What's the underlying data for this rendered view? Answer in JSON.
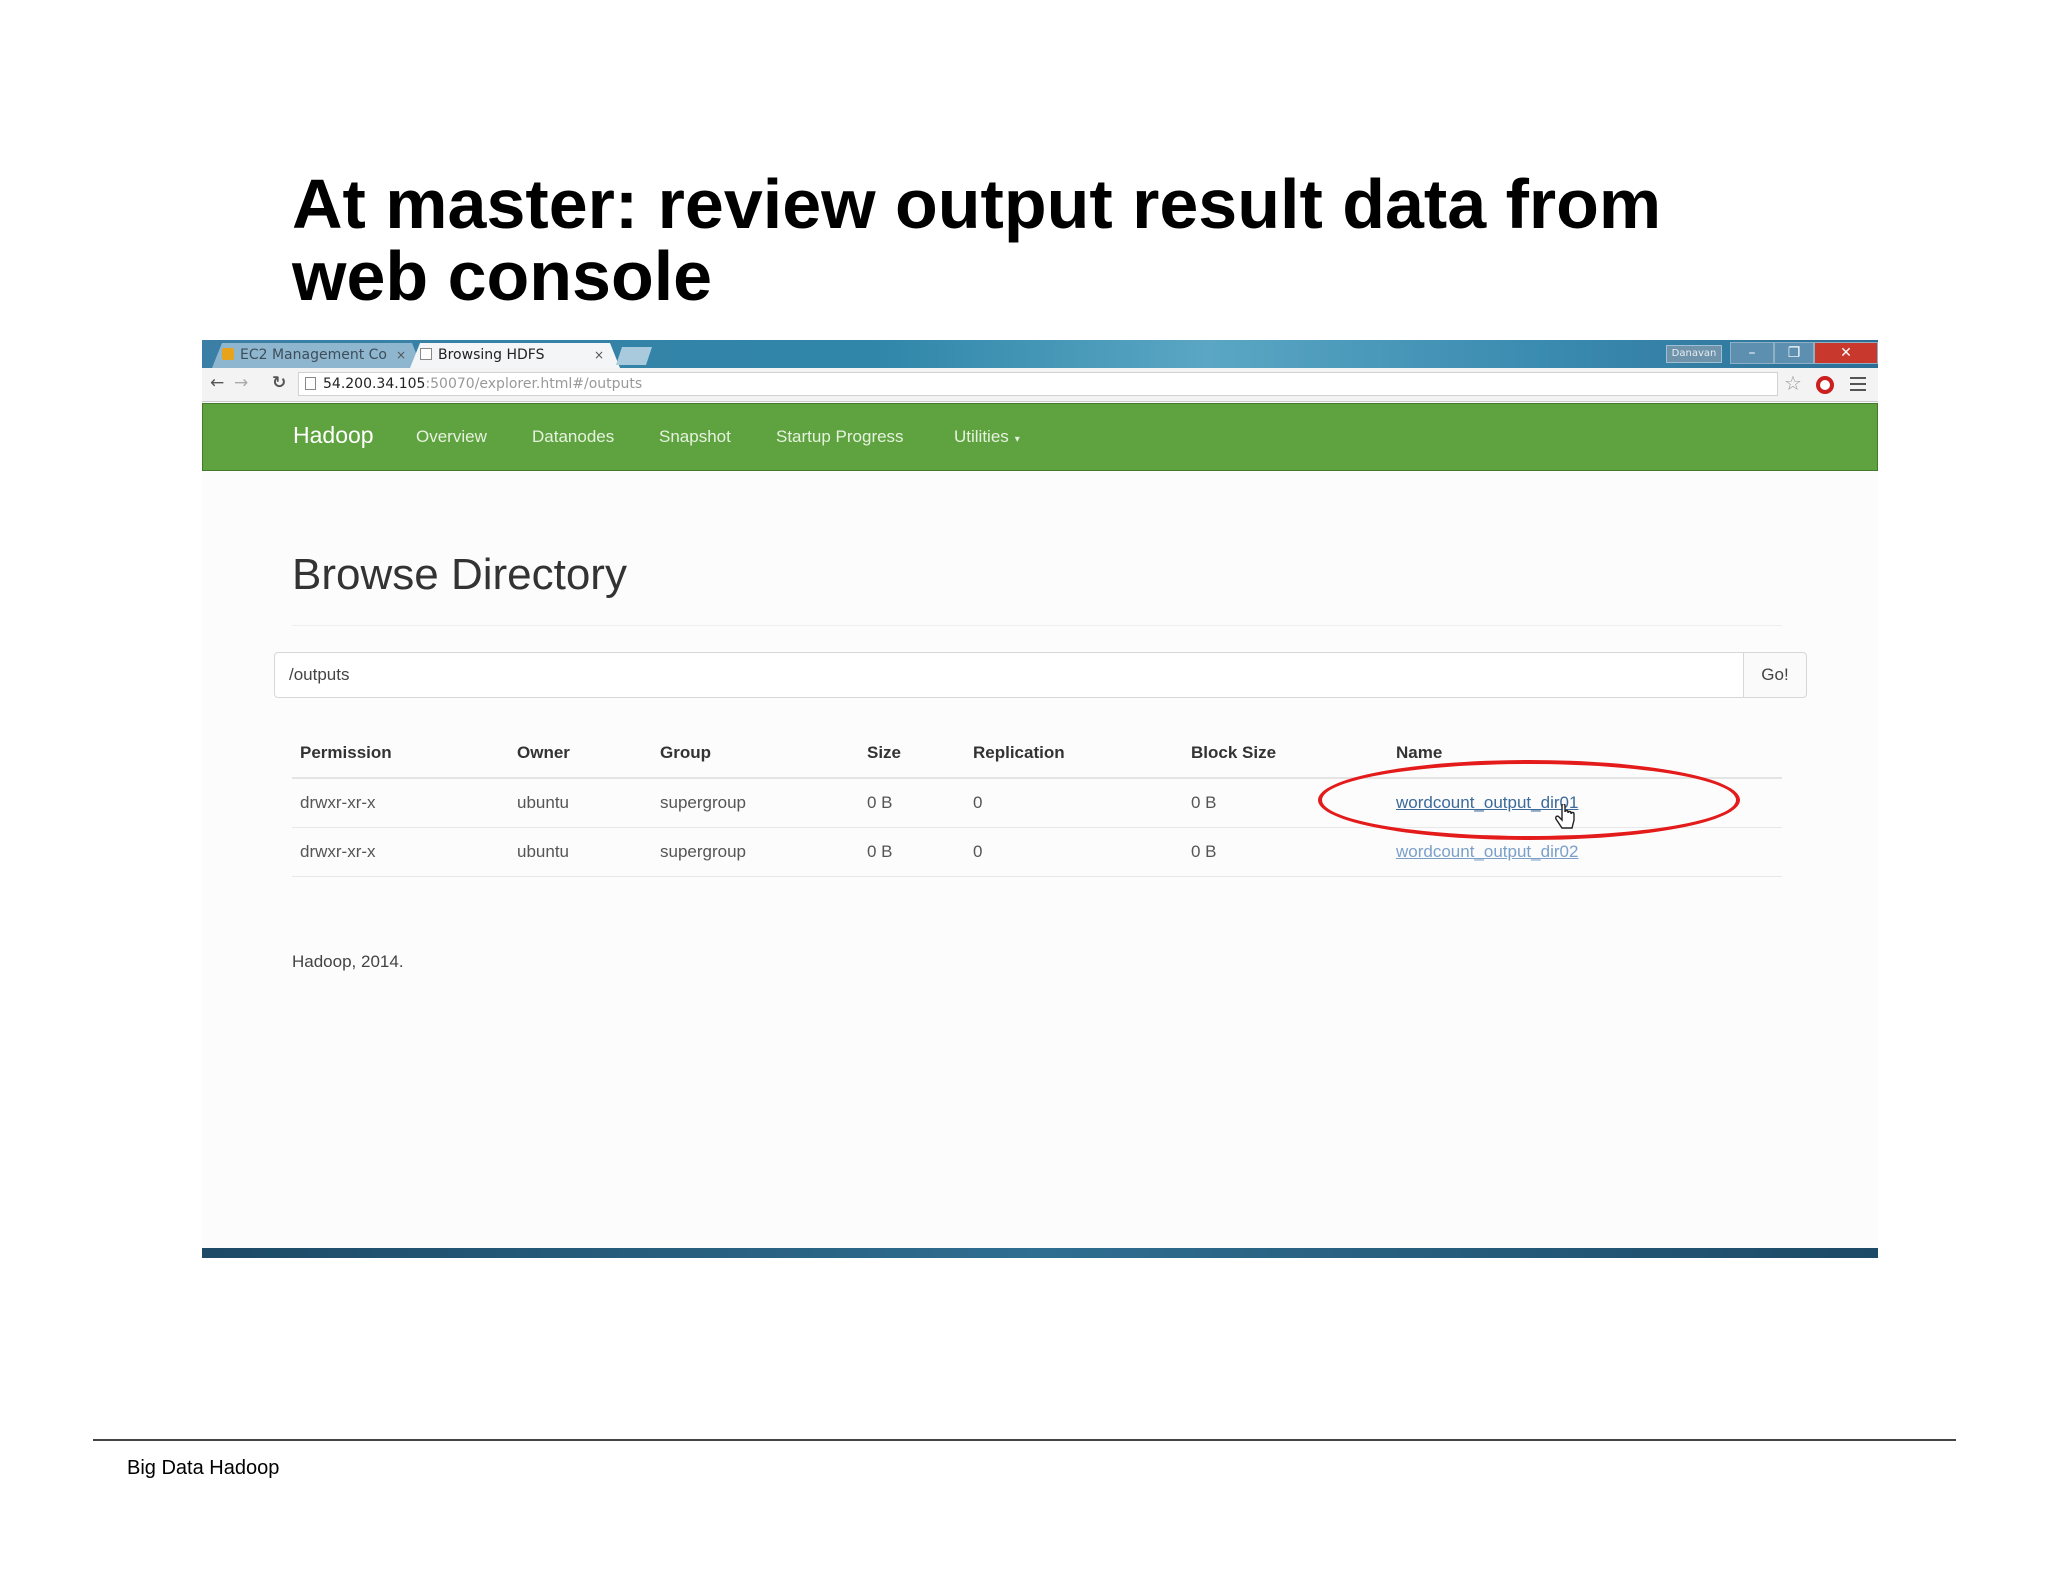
{
  "slide": {
    "title_line1": "At master: review output result data from",
    "title_line2": "web console",
    "footer": "Big Data Hadoop"
  },
  "browser": {
    "tabs": [
      {
        "label": "EC2 Management Co",
        "active": false
      },
      {
        "label": "Browsing HDFS",
        "active": true
      }
    ],
    "tab_close": "×",
    "user_badge": "Danavan",
    "url_host": "54.200.34.105",
    "url_rest": ":50070/explorer.html#/outputs"
  },
  "navbar": {
    "brand": "Hadoop",
    "links": [
      "Overview",
      "Datanodes",
      "Snapshot",
      "Startup Progress",
      "Utilities"
    ],
    "color": "#5ea33f"
  },
  "page": {
    "heading": "Browse Directory",
    "path_value": "/outputs",
    "go_label": "Go!",
    "footer": "Hadoop, 2014."
  },
  "table": {
    "headers": [
      "Permission",
      "Owner",
      "Group",
      "Size",
      "Replication",
      "Block Size",
      "Name"
    ],
    "rows": [
      [
        "drwxr-xr-x",
        "ubuntu",
        "supergroup",
        "0 B",
        "0",
        "0 B",
        "wordcount_output_dir01"
      ],
      [
        "drwxr-xr-x",
        "ubuntu",
        "supergroup",
        "0 B",
        "0",
        "0 B",
        "wordcount_output_dir02"
      ]
    ]
  },
  "annotation": {
    "highlight_color": "#e31b1b"
  }
}
